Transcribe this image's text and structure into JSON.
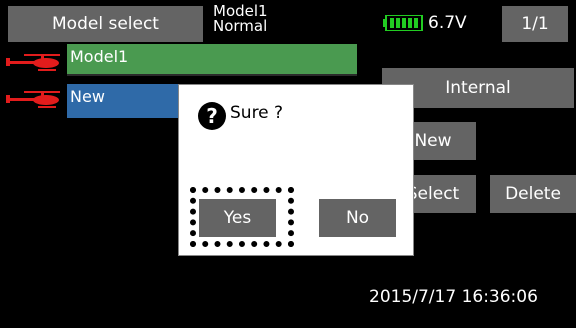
{
  "header": {
    "title": "Model select",
    "model_name": "Model1",
    "model_mode": "Normal",
    "battery_voltage": "6.7V",
    "battery_icon": "battery-icon",
    "page": "1/1"
  },
  "model_list": {
    "items": [
      {
        "label": "Model1",
        "icon": "helicopter-icon",
        "color": "#4a9a50"
      },
      {
        "label": "New",
        "icon": "helicopter-icon",
        "color": "#2f6aa8"
      }
    ]
  },
  "side_panel": {
    "internal_label": "Internal",
    "new_label": "New",
    "select_label": "Select",
    "delete_label": "Delete"
  },
  "dialog": {
    "icon": "question-icon",
    "message": "Sure ?",
    "yes_label": "Yes",
    "no_label": "No"
  },
  "status": {
    "datetime": "2015/7/17 16:36:06"
  },
  "colors": {
    "background": "#000000",
    "button": "#646464",
    "selected_row": "#4a9a50",
    "highlight_row": "#2f6aa8",
    "dialog": "#ffffff",
    "battery": "#22cc22",
    "icon_red": "#e21c1c"
  }
}
